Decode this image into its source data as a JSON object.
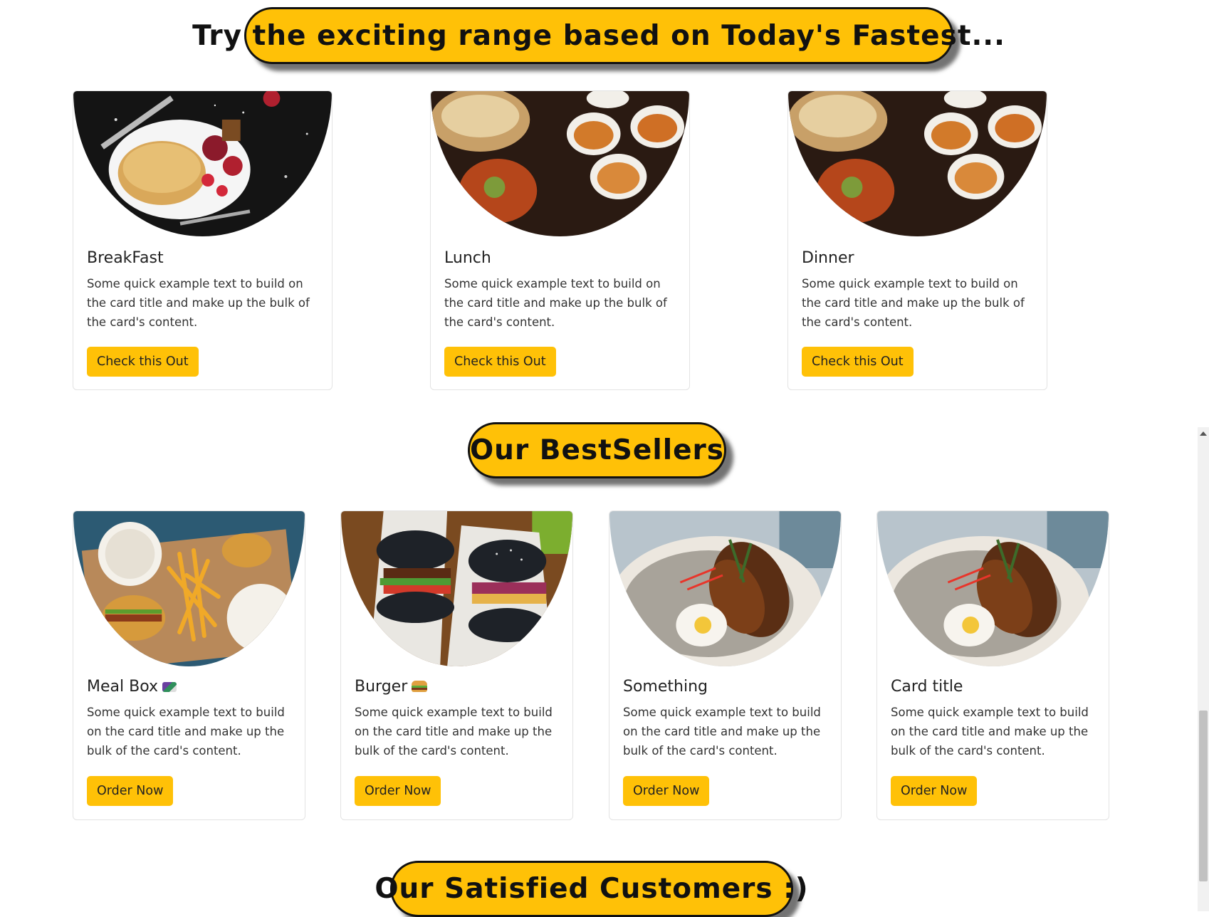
{
  "headings": {
    "fastest": "Try the exciting range based on Today's Fastest...",
    "bestsellers": "Our BestSellers",
    "customers": "Our Satisfied Customers :)"
  },
  "meals": [
    {
      "title": "BreakFast",
      "text": "Some quick example text to build on the card title and make up the bulk of the card's content.",
      "button": "Check this Out"
    },
    {
      "title": "Lunch",
      "text": "Some quick example text to build on the card title and make up the bulk of the card's content.",
      "button": "Check this Out"
    },
    {
      "title": "Dinner",
      "text": "Some quick example text to build on the card title and make up the bulk of the card's content.",
      "button": "Check this Out"
    }
  ],
  "bestsellers": [
    {
      "title": "Meal Box",
      "icon": "bento-box-icon",
      "text": "Some quick example text to build on the card title and make up the bulk of the card's content.",
      "button": "Order Now"
    },
    {
      "title": "Burger",
      "icon": "hamburger-icon",
      "text": "Some quick example text to build on the card title and make up the bulk of the card's content.",
      "button": "Order Now"
    },
    {
      "title": "Something",
      "text": "Some quick example text to build on the card title and make up the bulk of the card's content.",
      "button": "Order Now"
    },
    {
      "title": "Card title",
      "text": "Some quick example text to build on the card title and make up the bulk of the card's content.",
      "button": "Order Now"
    }
  ],
  "colors": {
    "accent": "#ffc107",
    "outline": "#111111"
  }
}
